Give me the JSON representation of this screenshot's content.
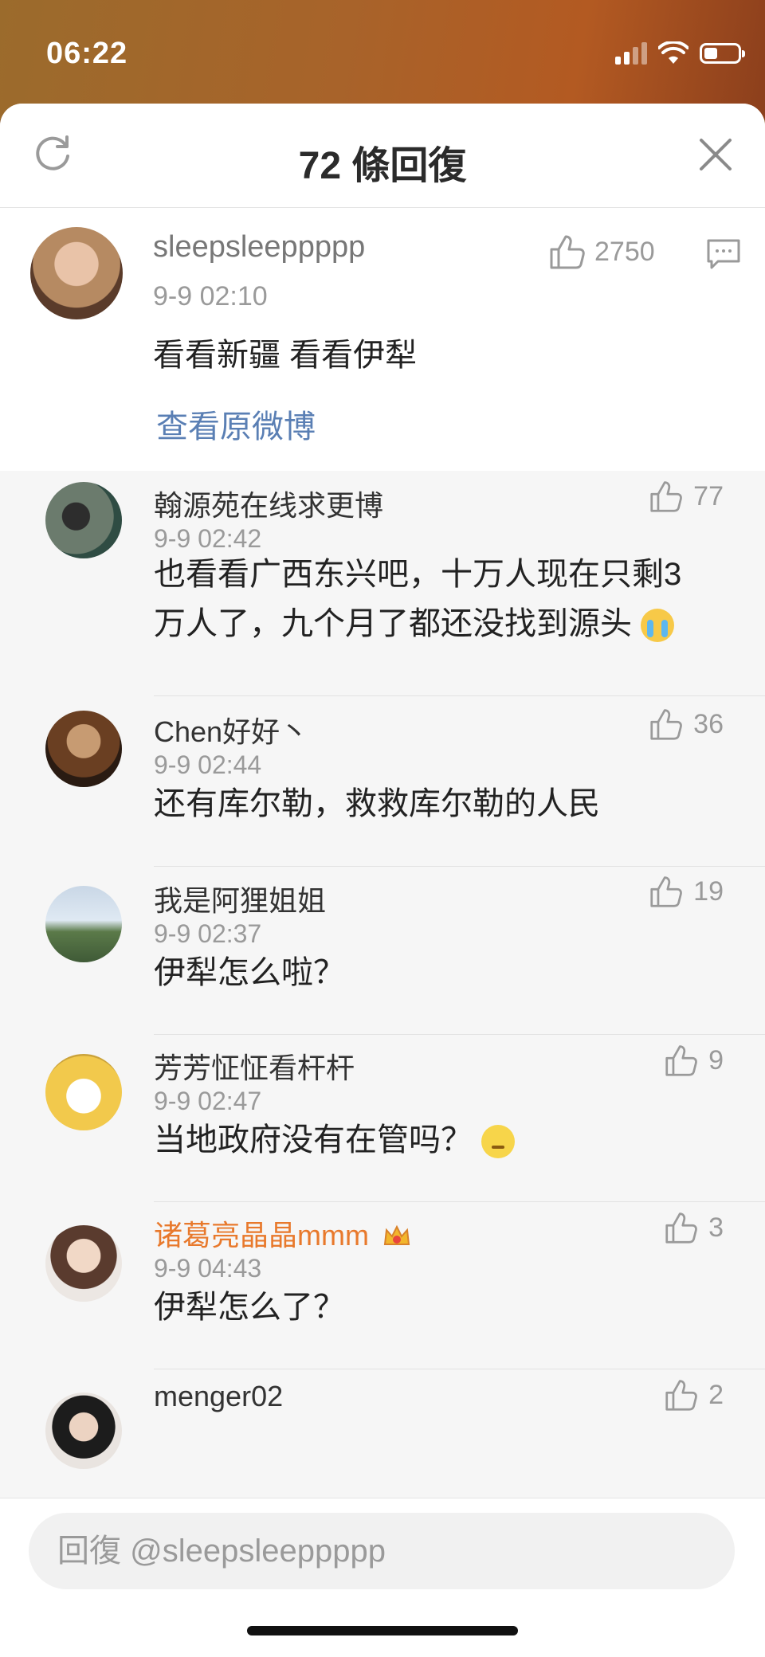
{
  "status_bar": {
    "time": "06:22"
  },
  "header": {
    "title": "72 條回復"
  },
  "main_comment": {
    "username": "sleepsleeppppp",
    "time": "9-9 02:10",
    "text": "看看新疆  看看伊犁",
    "like_count": "2750",
    "link": "查看原微博"
  },
  "replies": [
    {
      "username": "翰源苑在线求更博",
      "time": "9-9 02:42",
      "text": "也看看广西东兴吧，十万人现在只剩3万人了，九个月了都还没找到源头",
      "emoji": "cry-icon",
      "likes": "77"
    },
    {
      "username": "Chen好好丶",
      "time": "9-9 02:44",
      "text": "还有库尔勒，救救库尔勒的人民",
      "likes": "36"
    },
    {
      "username": "我是阿狸姐姐",
      "time": "9-9 02:37",
      "text": "伊犁怎么啦？",
      "likes": "19"
    },
    {
      "username": "芳芳怔怔看杆杆",
      "time": "9-9 02:47",
      "text": "当地政府没有在管吗？",
      "emoji": "thinking-icon",
      "likes": "9"
    },
    {
      "username": "诸葛亮晶晶mmm",
      "time": "9-9 04:43",
      "text": "伊犁怎么了？",
      "likes": "3",
      "highlight_color": "#e8792c"
    },
    {
      "username": "menger02",
      "likes": "2"
    }
  ],
  "footer": {
    "placeholder": "回復 @sleepsleeppppp"
  }
}
